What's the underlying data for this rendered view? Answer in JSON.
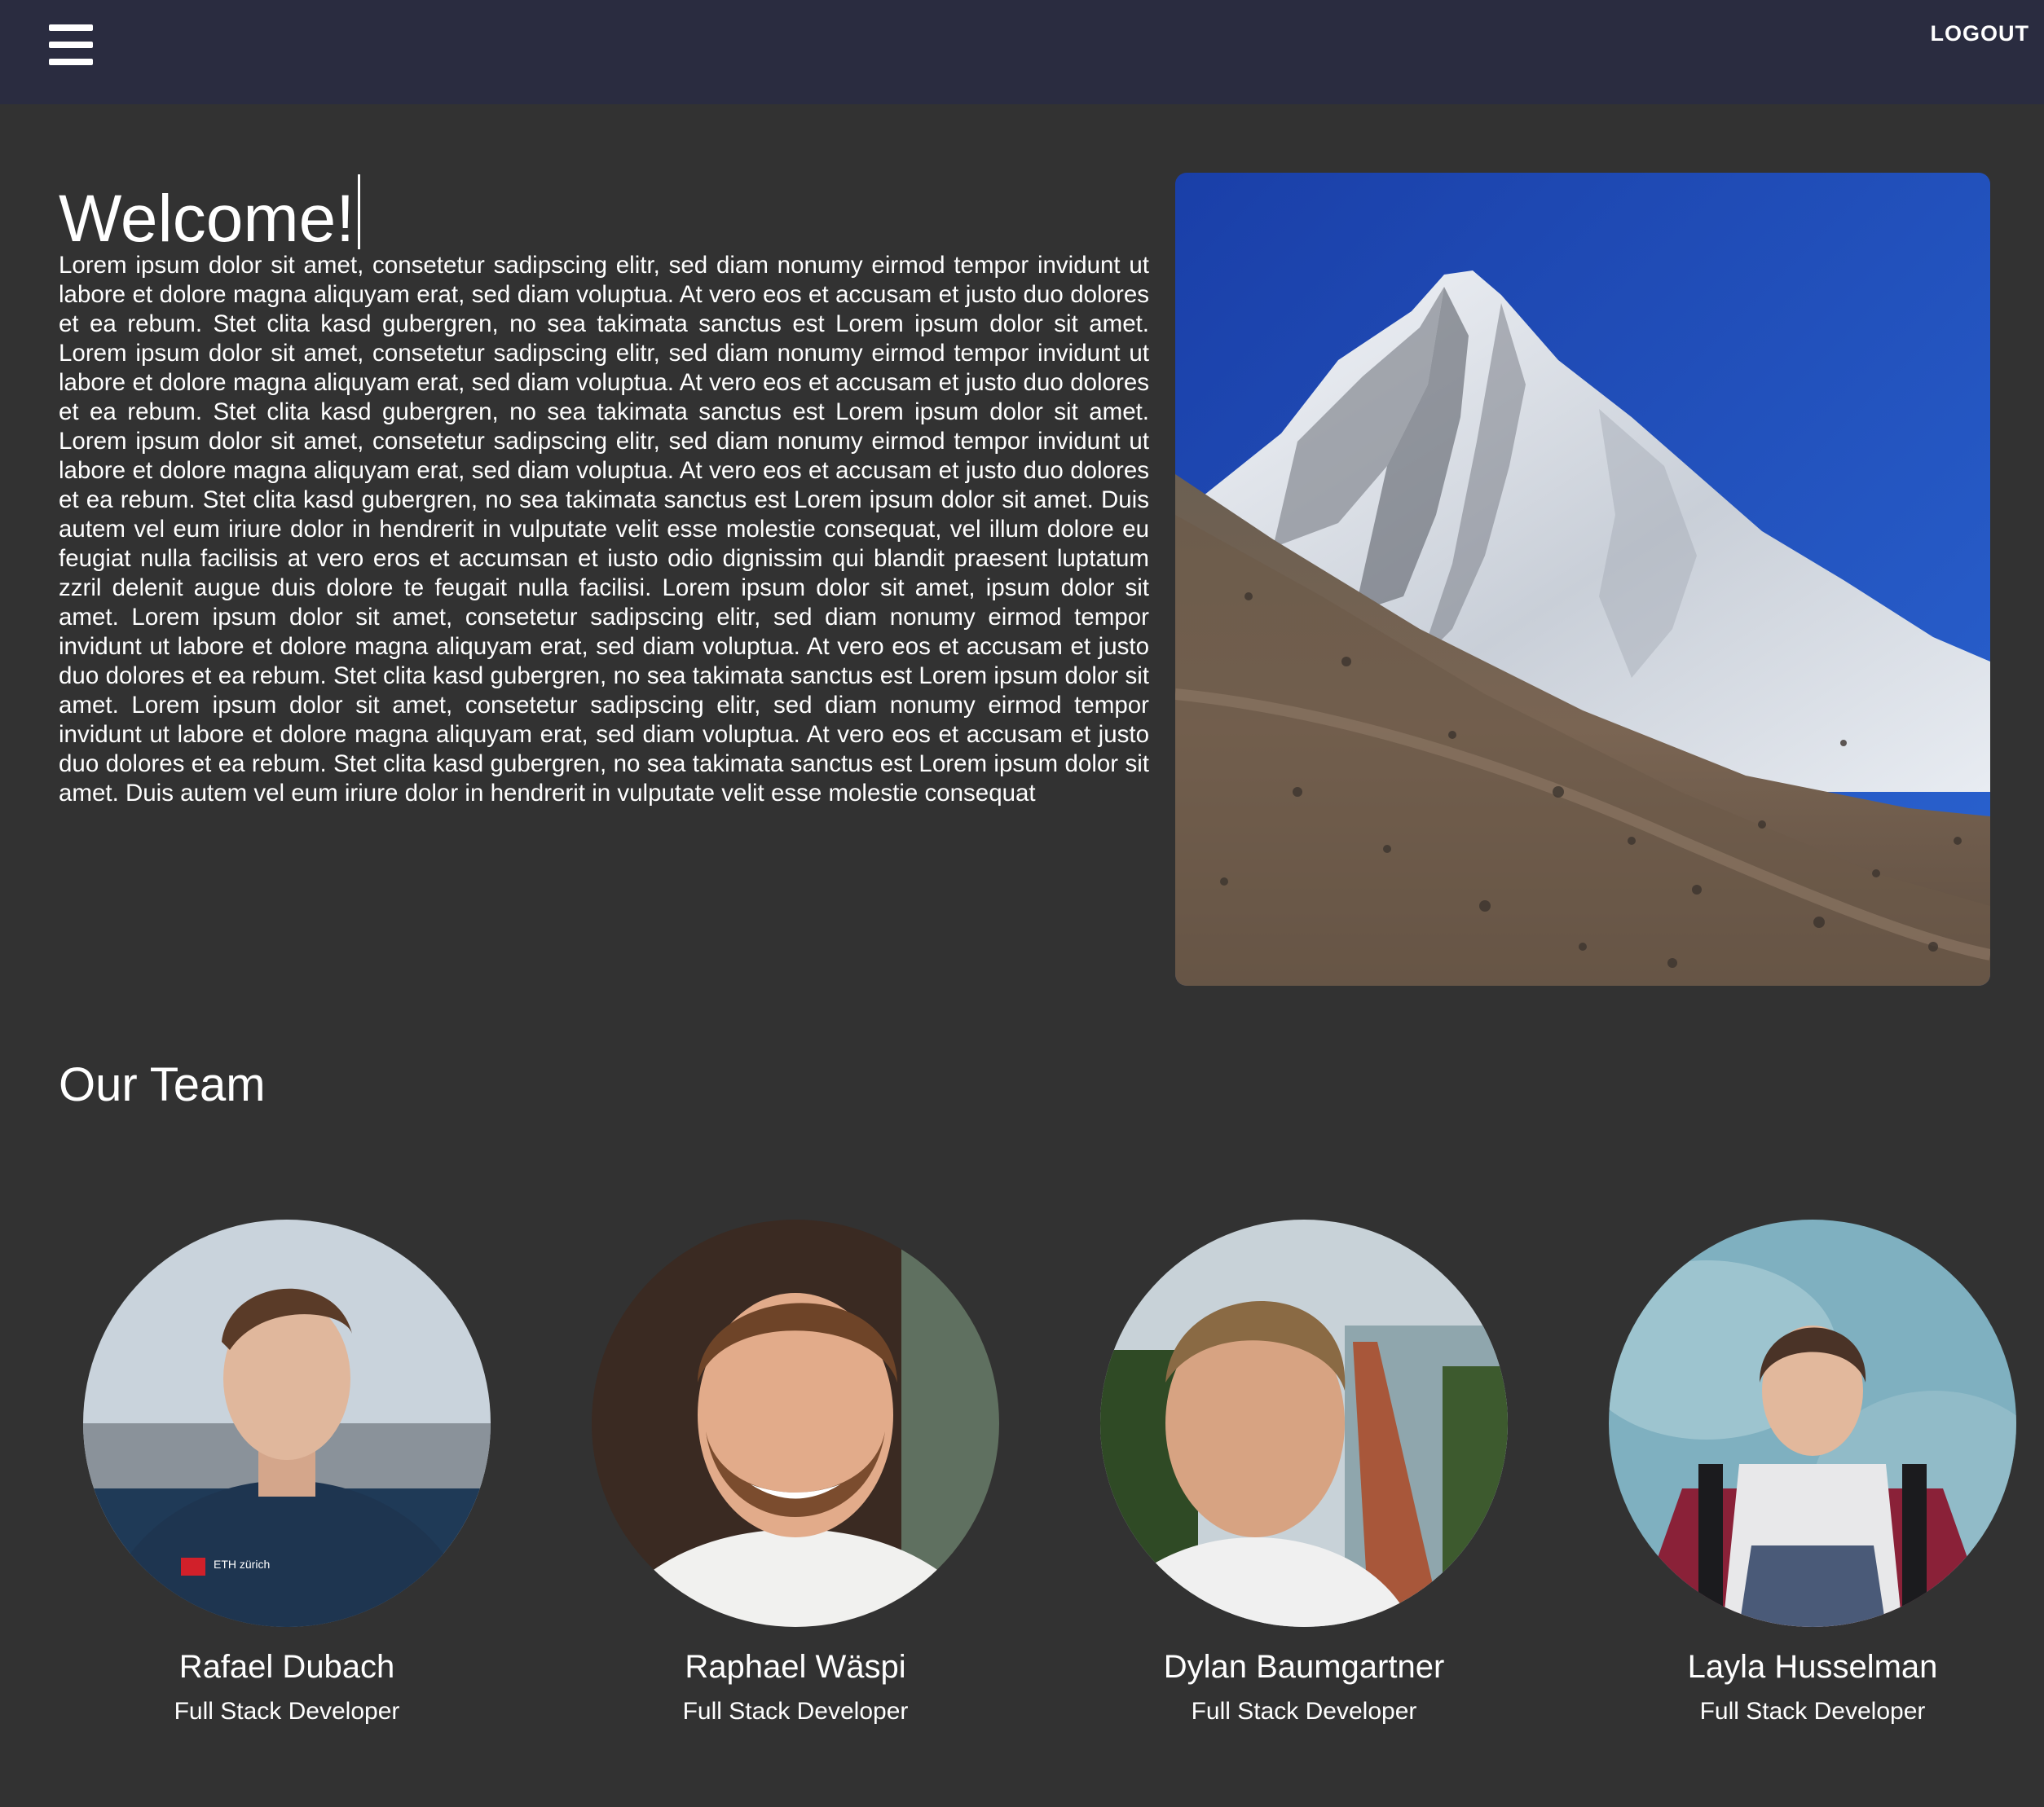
{
  "header": {
    "logout_label": "LOGOUT",
    "menu_icon": "hamburger-menu-icon"
  },
  "intro": {
    "title": "Welcome!",
    "body": "Lorem ipsum dolor sit amet, consetetur sadipscing elitr, sed diam nonumy eirmod tempor invidunt ut labore et dolore magna aliquyam erat, sed diam voluptua. At vero eos et accusam et justo duo dolores et ea rebum. Stet clita kasd gubergren, no sea takimata sanctus est Lorem ipsum dolor sit amet. Lorem ipsum dolor sit amet, consetetur sadipscing elitr, sed diam nonumy eirmod tempor invidunt ut labore et dolore magna aliquyam erat, sed diam voluptua. At vero eos et accusam et justo duo dolores et ea rebum. Stet clita kasd gubergren, no sea takimata sanctus est Lorem ipsum dolor sit amet. Lorem ipsum dolor sit amet, consetetur sadipscing elitr, sed diam nonumy eirmod tempor invidunt ut labore et dolore magna aliquyam erat, sed diam voluptua. At vero eos et accusam et justo duo dolores et ea rebum. Stet clita kasd gubergren, no sea takimata sanctus est Lorem ipsum dolor sit amet. Duis autem vel eum iriure dolor in hendrerit in vulputate velit esse molestie consequat, vel illum dolore eu feugiat nulla facilisis at vero eros et accumsan et iusto odio dignissim qui blandit praesent luptatum zzril delenit augue duis dolore te feugait nulla facilisi. Lorem ipsum dolor sit amet, ipsum dolor sit amet. Lorem ipsum dolor sit amet, consetetur sadipscing elitr, sed diam nonumy eirmod tempor invidunt ut labore et dolore magna aliquyam erat, sed diam voluptua. At vero eos et accusam et justo duo dolores et ea rebum. Stet clita kasd gubergren, no sea takimata sanctus est Lorem ipsum dolor sit amet. Lorem ipsum dolor sit amet, consetetur sadipscing elitr, sed diam nonumy eirmod tempor invidunt ut labore et dolore magna aliquyam erat, sed diam voluptua. At vero eos et accusam et justo duo dolores et ea rebum. Stet clita kasd gubergren, no sea takimata sanctus est Lorem ipsum dolor sit amet. Duis autem vel eum iriure dolor in hendrerit in vulputate velit esse molestie consequat"
  },
  "team": {
    "title": "Our Team",
    "members": [
      {
        "name": "Rafael Dubach",
        "role": "Full Stack Developer"
      },
      {
        "name": "Raphael Wäspi",
        "role": "Full Stack Developer"
      },
      {
        "name": "Dylan Baumgartner",
        "role": "Full Stack Developer"
      },
      {
        "name": "Layla Husselman",
        "role": "Full Stack Developer"
      }
    ]
  },
  "colors": {
    "header_bg": "#2a2c40",
    "page_bg": "#323232",
    "text": "#ffffff"
  }
}
